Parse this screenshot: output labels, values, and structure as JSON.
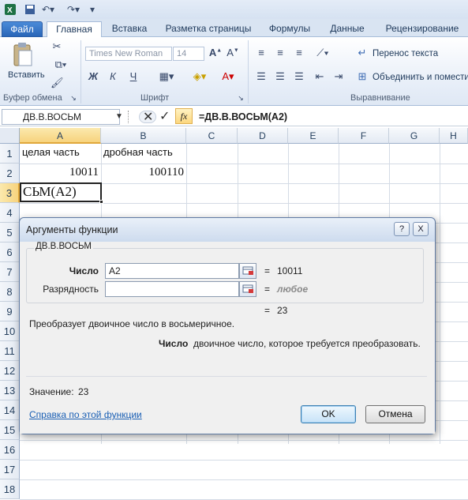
{
  "tabs": {
    "file": "Файл",
    "home": "Главная",
    "insert": "Вставка",
    "layout": "Разметка страницы",
    "formulas": "Формулы",
    "data": "Данные",
    "review": "Рецензирование"
  },
  "ribbon": {
    "paste_label": "Вставить",
    "clipboard_group": "Буфер обмена",
    "font_name": "Times New Roman",
    "font_size": "14",
    "font_group": "Шрифт",
    "wrap_text": "Перенос текста",
    "merge_center": "Объединить и помести",
    "alignment_group": "Выравнивание",
    "bold": "Ж",
    "italic": "К",
    "underline": "Ч"
  },
  "formula_bar": {
    "name_box": "ДВ.В.ВОСЬМ",
    "fx": "fx",
    "formula": "=ДВ.В.ВОСЬМ(A2)"
  },
  "sheet": {
    "columns": [
      "A",
      "B",
      "C",
      "D",
      "E",
      "F",
      "G",
      "H"
    ],
    "rows": [
      "1",
      "2",
      "3",
      "4",
      "5",
      "6",
      "7",
      "8",
      "9",
      "10",
      "11",
      "12",
      "13",
      "14",
      "15",
      "16",
      "17",
      "18"
    ],
    "cells": {
      "A1": "целая часть",
      "B1": "дробная часть",
      "A2": "10011",
      "B2": "100110",
      "A3": "СЬМ(A2)"
    }
  },
  "dialog": {
    "title": "Аргументы функции",
    "help_btn": "?",
    "close_btn": "X",
    "function_name": "ДВ.В.ВОСЬМ",
    "arg1_label": "Число",
    "arg1_value": "A2",
    "arg1_result": "10011",
    "arg2_label": "Разрядность",
    "arg2_value": "",
    "arg2_result": "любое",
    "eq": "=",
    "total_result": "23",
    "description": "Преобразует двоичное число в восьмеричное.",
    "arg_help_name": "Число",
    "arg_help_text": "двоичное число, которое требуется преобразовать.",
    "value_label": "Значение:",
    "value": "23",
    "help_link": "Справка по этой функции",
    "ok": "OK",
    "cancel": "Отмена"
  }
}
